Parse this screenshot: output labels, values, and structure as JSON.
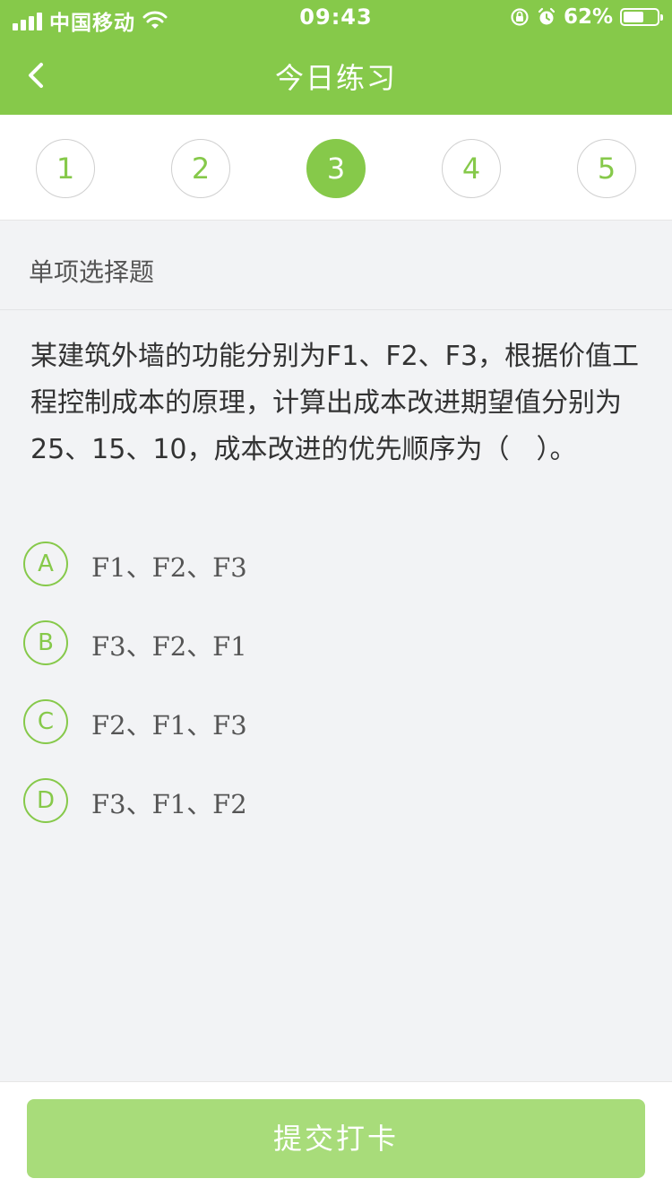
{
  "status_bar": {
    "carrier": "中国移动",
    "time": "09:43",
    "battery_percent": "62%",
    "battery_level": 0.62,
    "icons": [
      "signal-icon",
      "wifi-icon",
      "rotation-lock-icon",
      "alarm-icon",
      "battery-icon"
    ]
  },
  "header": {
    "title": "今日练习",
    "back_icon": "chevron-left-icon"
  },
  "steps": {
    "items": [
      "1",
      "2",
      "3",
      "4",
      "5"
    ],
    "active_index": 2
  },
  "question": {
    "type": "单项选择题",
    "text": "某建筑外墙的功能分别为F1、F2、F3，根据价值工程控制成本的原理，计算出成本改进期望值分别为25、15、10，成本改进的优先顺序为（　）。",
    "options": [
      {
        "letter": "A",
        "text": "F1、F2、F3"
      },
      {
        "letter": "B",
        "text": "F3、F2、F1"
      },
      {
        "letter": "C",
        "text": "F2、F1、F3"
      },
      {
        "letter": "D",
        "text": "F3、F1、F2"
      }
    ]
  },
  "footer": {
    "submit_label": "提交打卡"
  },
  "colors": {
    "primary": "#86c94a",
    "submit_disabled": "#a8dc7a",
    "background": "#f2f3f5"
  }
}
